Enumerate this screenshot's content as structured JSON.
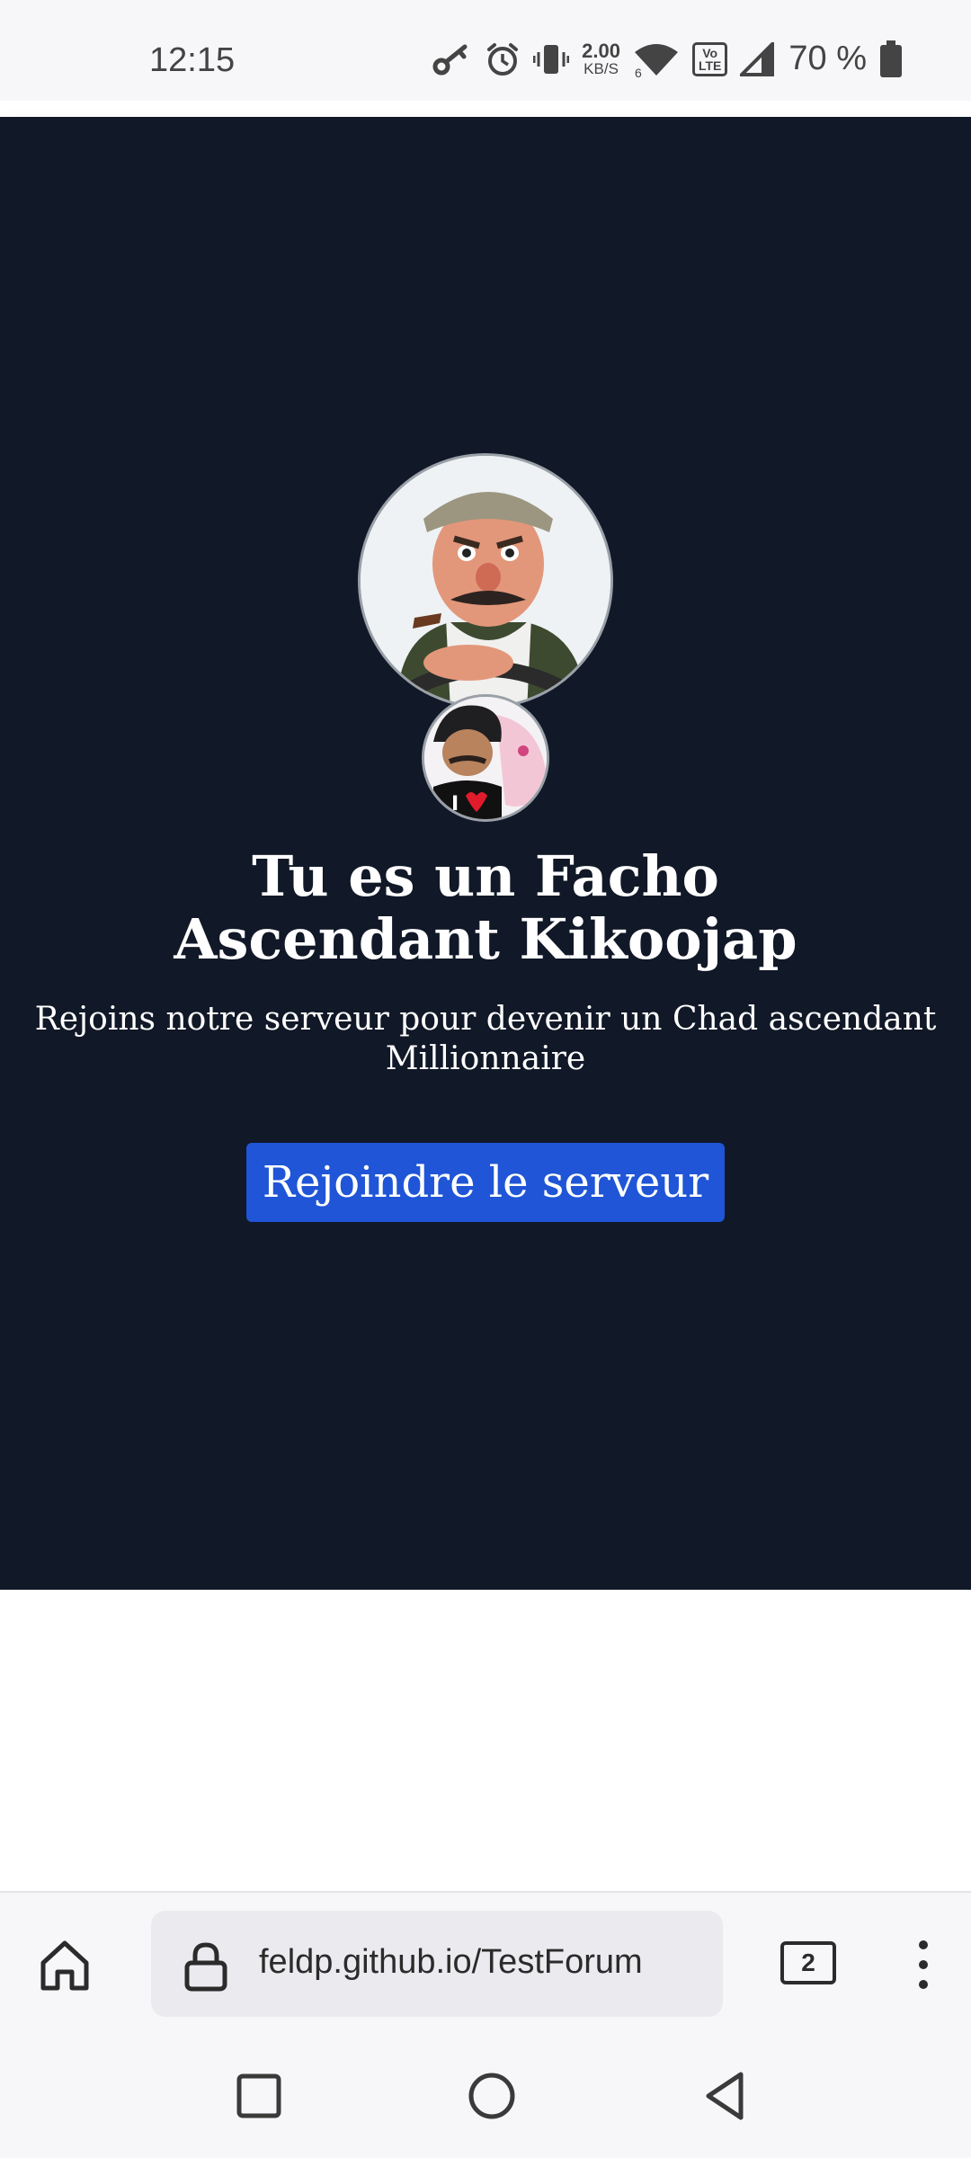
{
  "status_bar": {
    "time": "12:15",
    "net_speed_value": "2.00",
    "net_speed_unit": "KB/S",
    "volte_label": "Vo LTE",
    "battery_percent": "70 %",
    "icons": [
      "key-icon",
      "alarm-icon",
      "vibrate-icon",
      "wifi-icon",
      "volte-icon",
      "signal-icon",
      "battery-icon"
    ]
  },
  "page": {
    "title": "Tu es un Facho Ascendant Kikoojap",
    "subtitle": "Rejoins notre serveur pour devenir un Chad ascendant Millionnaire",
    "join_button": "Rejoindre le serveur",
    "colors": {
      "background": "#111827",
      "button": "#1f55d6",
      "text": "#ffffff"
    }
  },
  "browser": {
    "url": "feldp.github.io/TestForum",
    "tab_count": "2",
    "icons": [
      "home-icon",
      "lock-icon",
      "tabs-icon",
      "more-menu-icon"
    ]
  },
  "nav_bar": {
    "icons": [
      "recents-icon",
      "home-circle-icon",
      "back-icon"
    ]
  }
}
